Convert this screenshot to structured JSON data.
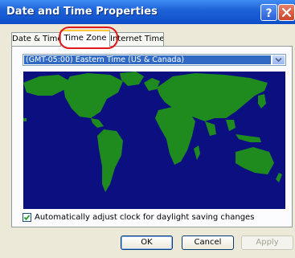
{
  "window": {
    "title": "Date and Time Properties"
  },
  "tabs": [
    {
      "label": "Date & Time"
    },
    {
      "label": "Time Zone"
    },
    {
      "label": "Internet Time"
    }
  ],
  "timezone": {
    "selected": "(GMT-05:00) Eastern Time (US & Canada)"
  },
  "daylight": {
    "label": "Automatically adjust clock for daylight saving changes",
    "checked": true
  },
  "buttons": {
    "ok": "OK",
    "cancel": "Cancel",
    "apply": "Apply"
  },
  "icons": {
    "help": "help-icon",
    "close": "close-icon",
    "dropdown": "chevron-down-icon",
    "check": "checkmark-icon"
  },
  "colors": {
    "title_bar": "#0c4ec8",
    "map_ocean": "#0c0f80",
    "map_land": "#1f8b1f",
    "highlight": "#e01818",
    "selection": "#316ac5"
  }
}
